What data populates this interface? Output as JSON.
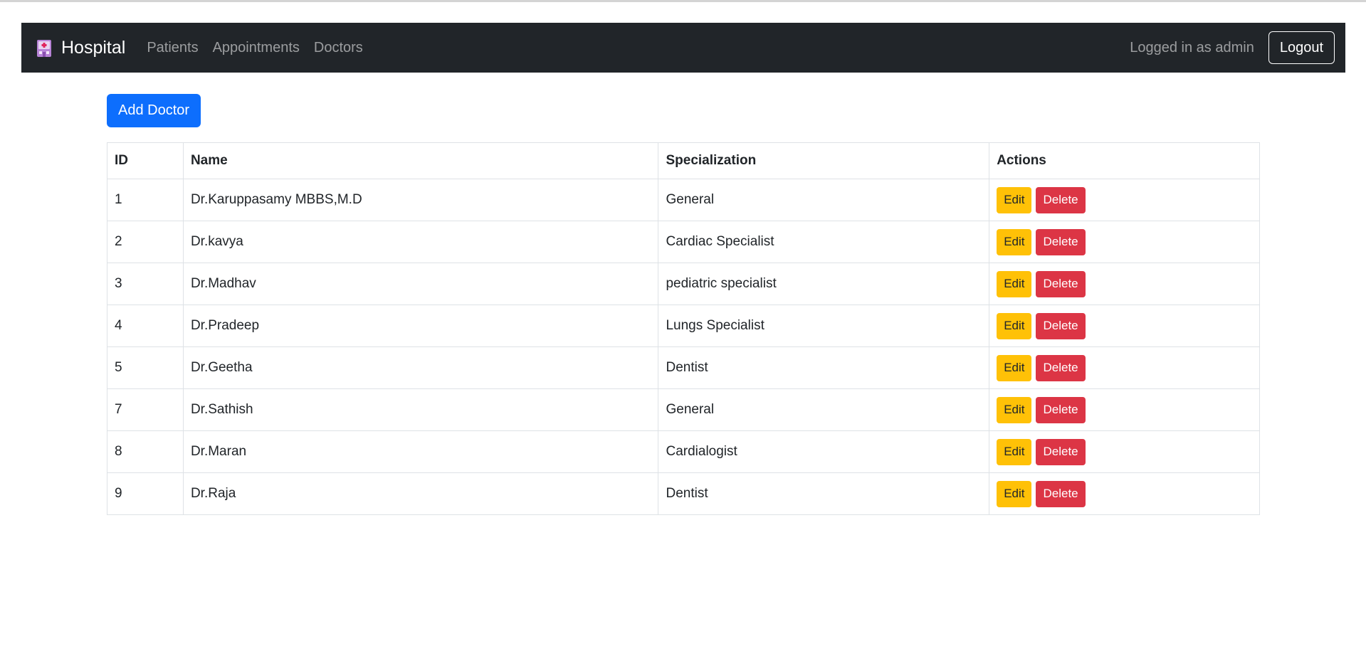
{
  "navbar": {
    "brand": "Hospital",
    "links": [
      "Patients",
      "Appointments",
      "Doctors"
    ],
    "status_text": "Logged in as admin",
    "logout_label": "Logout"
  },
  "toolbar": {
    "add_label": "Add Doctor"
  },
  "table": {
    "headers": [
      "ID",
      "Name",
      "Specialization",
      "Actions"
    ],
    "edit_label": "Edit",
    "delete_label": "Delete",
    "rows": [
      {
        "id": "1",
        "name": "Dr.Karuppasamy MBBS,M.D",
        "specialization": "General"
      },
      {
        "id": "2",
        "name": "Dr.kavya",
        "specialization": "Cardiac Specialist"
      },
      {
        "id": "3",
        "name": "Dr.Madhav",
        "specialization": "pediatric specialist"
      },
      {
        "id": "4",
        "name": "Dr.Pradeep",
        "specialization": "Lungs Specialist"
      },
      {
        "id": "5",
        "name": "Dr.Geetha",
        "specialization": "Dentist"
      },
      {
        "id": "7",
        "name": "Dr.Sathish",
        "specialization": "General"
      },
      {
        "id": "8",
        "name": "Dr.Maran",
        "specialization": "Cardialogist"
      },
      {
        "id": "9",
        "name": "Dr.Raja",
        "specialization": "Dentist"
      }
    ]
  },
  "colors": {
    "navbar_bg": "#212529",
    "primary": "#0d6efd",
    "warning": "#ffc107",
    "danger": "#dc3545"
  },
  "icons": {
    "brand": "hospital-icon"
  }
}
